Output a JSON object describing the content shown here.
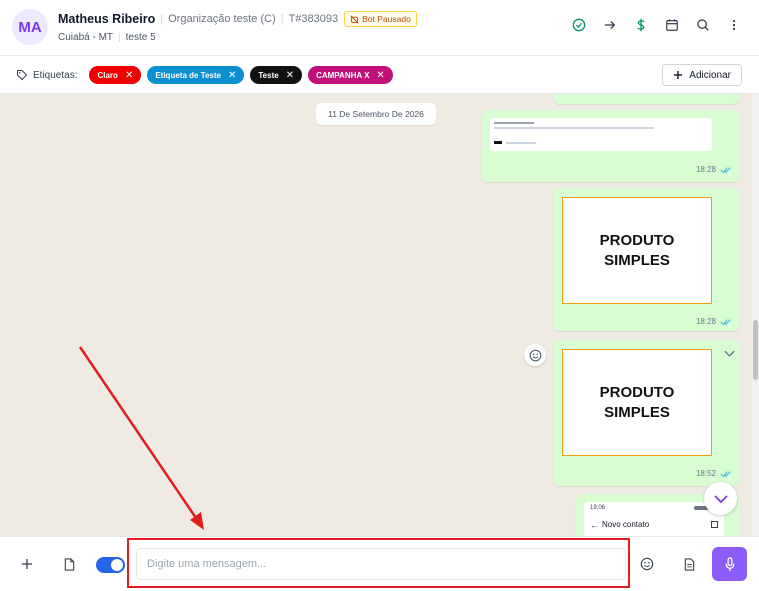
{
  "header": {
    "avatar_initials": "MA",
    "contact_name": "Matheus Ribeiro",
    "organization": "Organização teste (C)",
    "ticket": "T#383093",
    "bot_badge": "Bot Pausado",
    "location": "Cuiabá - MT",
    "queue": "teste 5",
    "actions": [
      "check-circle-icon",
      "arrow-right-icon",
      "dollar-icon",
      "calendar-icon",
      "search-icon",
      "more-vertical-icon"
    ]
  },
  "tags": {
    "label": "Etiquetas:",
    "items": [
      {
        "label": "Claro",
        "color": "#ef0000"
      },
      {
        "label": "Etiqueta de Teste",
        "color": "#0a8fd1"
      },
      {
        "label": "Teste",
        "color": "#111111"
      },
      {
        "label": "CAMPANHA X",
        "color": "#c0117a"
      }
    ],
    "add_label": "Adicionar"
  },
  "chat": {
    "date_chip": "11 De Setembro De 2026",
    "messages": [
      {
        "type": "document",
        "time": "18:28"
      },
      {
        "type": "image",
        "image_text_line1": "PRODUTO",
        "image_text_line2": "SIMPLES",
        "time": "18:28"
      },
      {
        "type": "image",
        "image_text_line1": "PRODUTO",
        "image_text_line2": "SIMPLES",
        "time": "18:52"
      },
      {
        "type": "contact-screenshot",
        "phone_time": "19:06",
        "phone_title": "Novo contato"
      }
    ]
  },
  "composer": {
    "placeholder": "Digite uma mensagem..."
  },
  "colors": {
    "accent": "#7c3aed",
    "bubble": "#d9fdd3",
    "chat_bg": "#efeae2",
    "annotation": "#e11d1d"
  }
}
